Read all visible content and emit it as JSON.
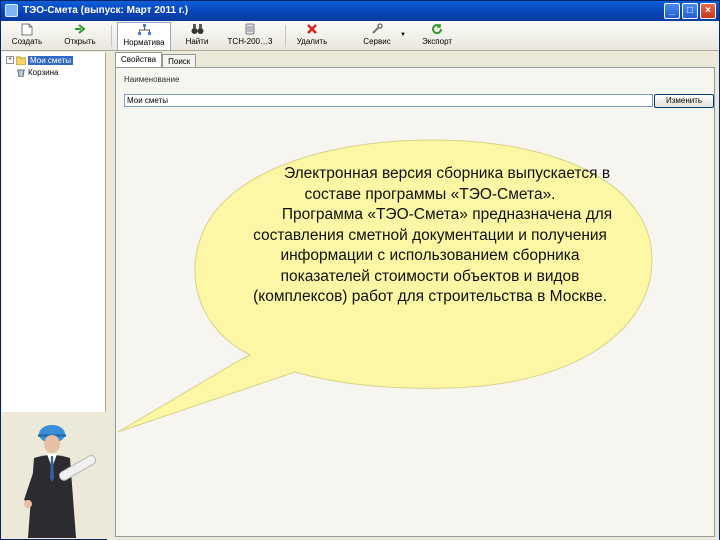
{
  "window": {
    "title": "ТЭО-Смета  (выпуск: Март 2011 г.)",
    "controls": [
      "_",
      "□",
      "×"
    ]
  },
  "toolbar": {
    "create": "Создать",
    "open": "Открыть",
    "normatives": "Норматива",
    "find": "Найти",
    "tsn": "ТСН-200…3",
    "delete": "Удалить",
    "service": "Сервис",
    "export": "Экспорт"
  },
  "tree": {
    "items": [
      {
        "label": "Мои сметы",
        "selected": true,
        "expander": "+"
      },
      {
        "label": "Корзина",
        "selected": false,
        "expander": ""
      }
    ]
  },
  "tabs": [
    {
      "label": "Свойства",
      "active": true
    },
    {
      "label": "Поиск",
      "active": false
    }
  ],
  "properties": {
    "name_label": "Наименование",
    "name_value": "Мои сметы",
    "rename_button": "Изменить"
  },
  "callout": {
    "paragraph1": "Электронная версия сборника выпускается в составе программы «ТЭО-Смета».",
    "paragraph2": "Программа «ТЭО-Смета» предназначена для составления сметной документации и получения информации с использованием сборника показателей стоимости объектов и видов (комплексов) работ для строительства в Москве.",
    "fill_color": "#fcf7a5"
  },
  "colors": {
    "titlebar": "#0a4ac6",
    "selection": "#316ac5",
    "window_bg": "#ece9d8",
    "delete_icon": "#d42020",
    "export_icon": "#2e9a2e"
  }
}
